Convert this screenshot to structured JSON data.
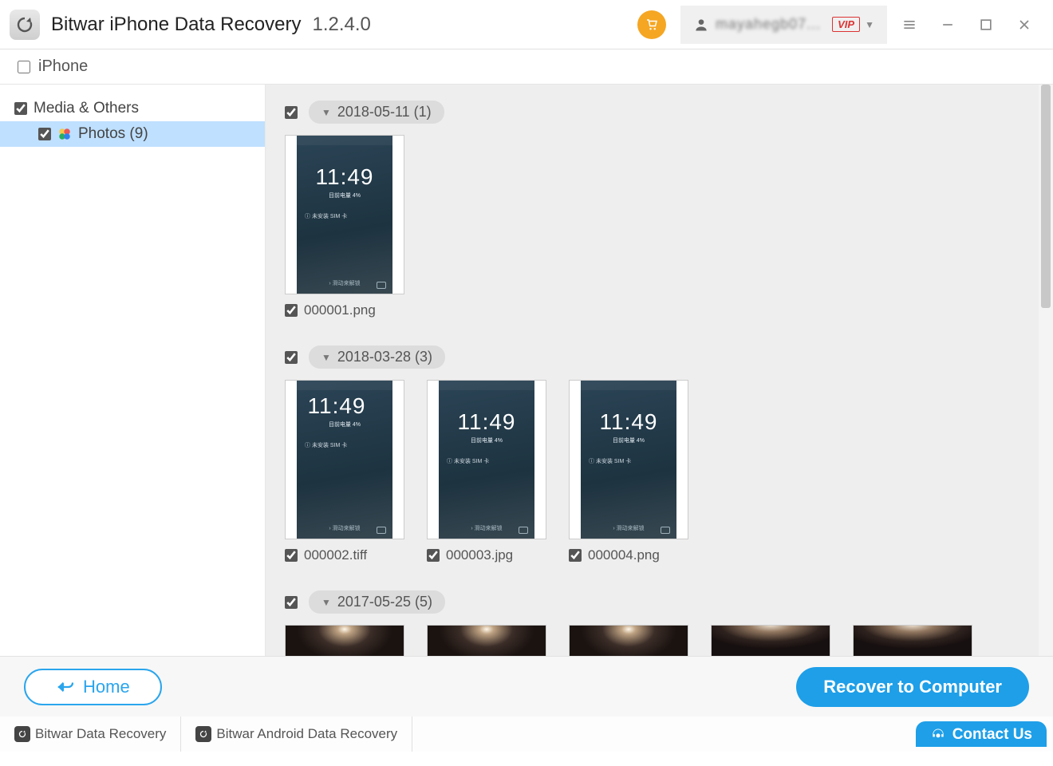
{
  "title": "Bitwar iPhone Data Recovery",
  "version": "1.2.4.0",
  "user_name": "mayahegb07...",
  "vip_label": "VIP",
  "device": {
    "label": "iPhone",
    "checked": false
  },
  "sidebar": {
    "category": {
      "label": "Media & Others",
      "checked": true
    },
    "photos": {
      "label": "Photos (9)",
      "checked": true
    }
  },
  "groups": [
    {
      "date_label": "2018-05-11 (1)",
      "checked": true,
      "items": [
        {
          "filename": "000001.png",
          "checked": true,
          "kind": "screenshot"
        }
      ]
    },
    {
      "date_label": "2018-03-28 (3)",
      "checked": true,
      "items": [
        {
          "filename": "000002.tiff",
          "checked": true,
          "kind": "screenshot-cropped"
        },
        {
          "filename": "000003.jpg",
          "checked": true,
          "kind": "screenshot"
        },
        {
          "filename": "000004.png",
          "checked": true,
          "kind": "screenshot"
        }
      ]
    },
    {
      "date_label": "2017-05-25 (5)",
      "checked": true,
      "items": [
        {
          "filename": "",
          "checked": true,
          "kind": "dark"
        },
        {
          "filename": "",
          "checked": true,
          "kind": "dark"
        },
        {
          "filename": "",
          "checked": true,
          "kind": "dark"
        },
        {
          "filename": "",
          "checked": true,
          "kind": "dark-shift"
        },
        {
          "filename": "",
          "checked": true,
          "kind": "dark-shift"
        }
      ]
    }
  ],
  "screenshot_content": {
    "clock": "11:49",
    "sub": "目前电量 4%",
    "sim": "未安装 SIM 卡",
    "slide": "› 滑动来解锁"
  },
  "buttons": {
    "home": "Home",
    "recover": "Recover to Computer"
  },
  "footer": {
    "link1": "Bitwar Data Recovery",
    "link2": "Bitwar Android Data Recovery",
    "contact": "Contact Us"
  }
}
